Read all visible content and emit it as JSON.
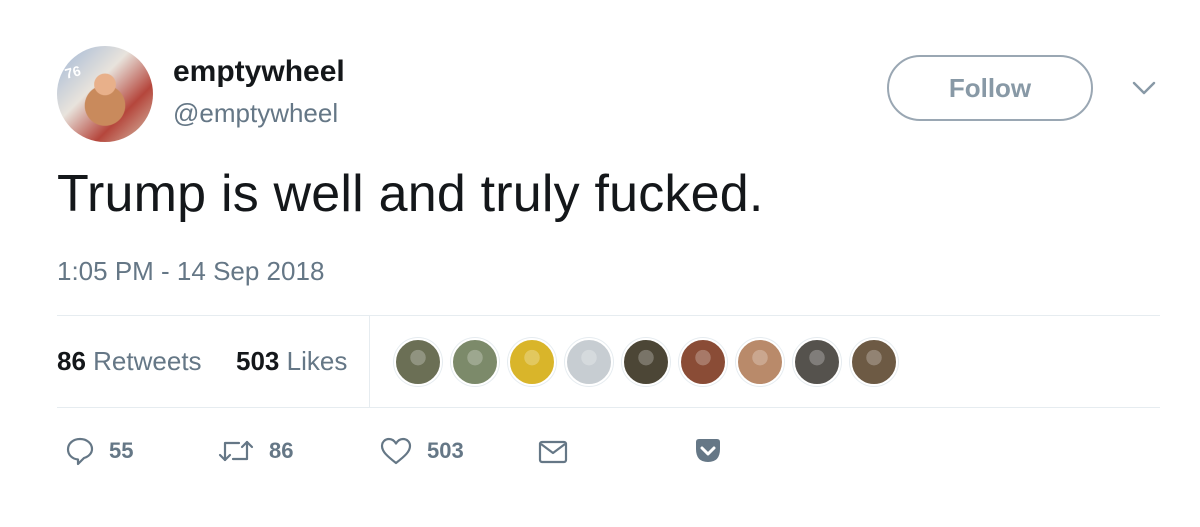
{
  "tweet": {
    "display_name": "emptywheel",
    "handle": "@emptywheel",
    "avatar_badge": "76",
    "text": "Trump is well and truly fucked.",
    "timestamp": "1:05 PM - 14 Sep 2018",
    "follow_label": "Follow"
  },
  "stats": {
    "retweets_count": "86",
    "retweets_label": "Retweets",
    "likes_count": "503",
    "likes_label": "Likes"
  },
  "likers": [
    {
      "name": "liker-avatar-1",
      "color": "#6b6f55"
    },
    {
      "name": "liker-avatar-2",
      "color": "#7c8a6a"
    },
    {
      "name": "liker-avatar-3",
      "color": "#d9b52a"
    },
    {
      "name": "liker-avatar-4",
      "color": "#c7cdd2"
    },
    {
      "name": "liker-avatar-5",
      "color": "#4c4636"
    },
    {
      "name": "liker-avatar-6",
      "color": "#8a4c36"
    },
    {
      "name": "liker-avatar-7",
      "color": "#b98a6a"
    },
    {
      "name": "liker-avatar-8",
      "color": "#55524d"
    },
    {
      "name": "liker-avatar-9",
      "color": "#6d5a44"
    }
  ],
  "actions": {
    "reply_count": "55",
    "retweet_count": "86",
    "like_count": "503"
  },
  "colors": {
    "text": "#14171a",
    "secondary": "#657786",
    "divider": "#e6ecf0"
  },
  "icons": [
    "reply-icon",
    "retweet-icon",
    "like-icon",
    "direct-message-icon",
    "pocket-icon",
    "chevron-down-icon"
  ]
}
